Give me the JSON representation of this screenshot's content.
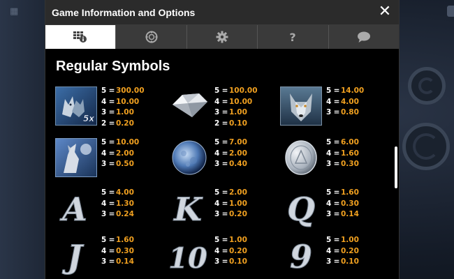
{
  "background": {
    "left_label": "▦"
  },
  "header": {
    "title": "Game Information and Options",
    "close_icon": "close-icon"
  },
  "tabs": [
    {
      "name": "paytable",
      "icon": "paytable-info-icon",
      "active": true
    },
    {
      "name": "rules",
      "icon": "chip-icon",
      "active": false
    },
    {
      "name": "settings",
      "icon": "gear-icon",
      "active": false
    },
    {
      "name": "help",
      "icon": "question-icon",
      "active": false
    },
    {
      "name": "chat",
      "icon": "speech-bubble-icon",
      "active": false
    }
  ],
  "section": {
    "title": "Regular Symbols"
  },
  "multiplier_badge": "5x",
  "symbols": [
    {
      "name": "wolf-pack-wild",
      "pays": [
        [
          "5",
          "300.00"
        ],
        [
          "4",
          "10.00"
        ],
        [
          "3",
          "1.00"
        ],
        [
          "2",
          "0.20"
        ]
      ]
    },
    {
      "name": "diamond",
      "pays": [
        [
          "5",
          "100.00"
        ],
        [
          "4",
          "10.00"
        ],
        [
          "3",
          "1.00"
        ],
        [
          "2",
          "0.10"
        ]
      ]
    },
    {
      "name": "wolf-face",
      "pays": [
        [
          "5",
          "14.00"
        ],
        [
          "4",
          "4.00"
        ],
        [
          "3",
          "0.80"
        ]
      ]
    },
    {
      "name": "howling-wolf",
      "pays": [
        [
          "5",
          "10.00"
        ],
        [
          "4",
          "2.00"
        ],
        [
          "3",
          "0.50"
        ]
      ]
    },
    {
      "name": "moon",
      "pays": [
        [
          "5",
          "7.00"
        ],
        [
          "4",
          "2.00"
        ],
        [
          "3",
          "0.40"
        ]
      ]
    },
    {
      "name": "silver-coin",
      "pays": [
        [
          "5",
          "6.00"
        ],
        [
          "4",
          "1.60"
        ],
        [
          "3",
          "0.30"
        ]
      ]
    },
    {
      "name": "letter-a",
      "glyph": "A",
      "pays": [
        [
          "5",
          "4.00"
        ],
        [
          "4",
          "1.30"
        ],
        [
          "3",
          "0.24"
        ]
      ]
    },
    {
      "name": "letter-k",
      "glyph": "K",
      "pays": [
        [
          "5",
          "2.00"
        ],
        [
          "4",
          "1.00"
        ],
        [
          "3",
          "0.20"
        ]
      ]
    },
    {
      "name": "letter-q",
      "glyph": "Q",
      "pays": [
        [
          "5",
          "1.60"
        ],
        [
          "4",
          "0.30"
        ],
        [
          "3",
          "0.14"
        ]
      ]
    },
    {
      "name": "letter-j",
      "glyph": "J",
      "pays": [
        [
          "5",
          "1.60"
        ],
        [
          "4",
          "0.30"
        ],
        [
          "3",
          "0.14"
        ]
      ]
    },
    {
      "name": "number-10",
      "glyph": "10",
      "pays": [
        [
          "5",
          "1.00"
        ],
        [
          "4",
          "0.20"
        ],
        [
          "3",
          "0.10"
        ]
      ]
    },
    {
      "name": "number-9",
      "glyph": "9",
      "pays": [
        [
          "5",
          "1.00"
        ],
        [
          "4",
          "0.20"
        ],
        [
          "3",
          "0.10"
        ]
      ]
    }
  ],
  "colors": {
    "pay_value": "#f0a020",
    "active_tab": "#ffffff",
    "tab_bar": "#3a3a3a",
    "header_bg": "#2b2b2b"
  }
}
